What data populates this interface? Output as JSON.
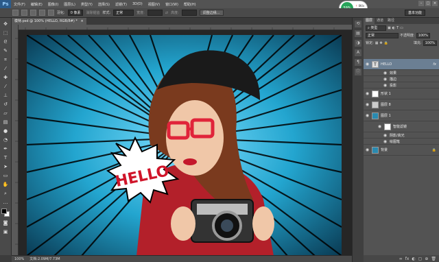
{
  "app": {
    "logo": "Ps",
    "menu": [
      "文件(F)",
      "编辑(E)",
      "图像(I)",
      "图层(L)",
      "类型(Y)",
      "选择(S)",
      "滤镜(T)",
      "3D(D)",
      "视图(V)",
      "窗口(W)",
      "帮助(H)"
    ]
  },
  "window_controls": [
    "–",
    "□",
    "×"
  ],
  "badge": {
    "percent": "59%",
    "up": "0K/s",
    "down": "0K/s"
  },
  "options": {
    "feather_label": "羽化:",
    "feather_value": "0 像素",
    "antialias_label": "消除锯齿",
    "style_label": "样式:",
    "style_value": "正常",
    "width_label": "宽度:",
    "height_label": "高度:",
    "refine_edge": "调整边缘...",
    "workspace": "基本功能"
  },
  "document": {
    "tab_title": "模特.psd @ 100% (HELLO, RGB/8#) *",
    "close": "×"
  },
  "status": {
    "zoom": "100%",
    "doc_info": "文档:2.09M/7.73M"
  },
  "artwork": {
    "bubble_text": "HELLO"
  },
  "panel": {
    "tabs": [
      "图层",
      "通道",
      "路径"
    ],
    "filter_label": "类型",
    "blend_mode": "正常",
    "opacity_label": "不透明度:",
    "opacity_value": "100%",
    "lock_label": "锁定:",
    "fill_label": "填充:",
    "fill_value": "100%",
    "layers": [
      {
        "name": "HELLO",
        "fx": "fx"
      },
      {
        "name": "效果"
      },
      {
        "name": "描边"
      },
      {
        "name": "投影"
      },
      {
        "name": "形状 1"
      },
      {
        "name": "图层 8"
      },
      {
        "name": "图层 1"
      },
      {
        "name": "智能滤镜"
      },
      {
        "name": "阴影/高光"
      },
      {
        "name": "绘图笔"
      },
      {
        "name": "背景"
      }
    ],
    "bottom_icons": [
      "fx",
      "◐",
      "▢",
      "⊕",
      "🗑"
    ]
  }
}
